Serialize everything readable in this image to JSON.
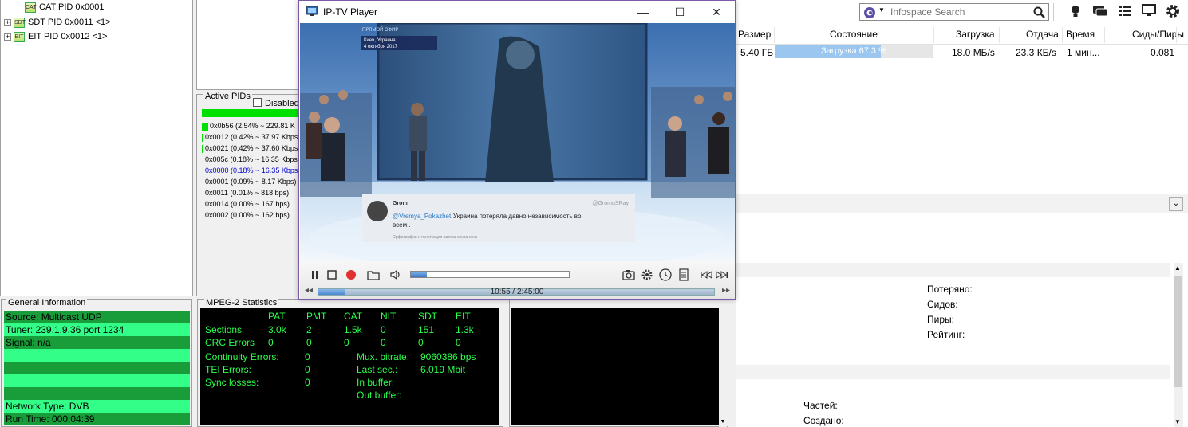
{
  "tree": {
    "items": [
      {
        "label": "CAT PID 0x0001",
        "expandable": false,
        "icon_text": "CAT"
      },
      {
        "label": "SDT PID 0x0011 <1>",
        "expandable": true,
        "icon_text": "SDT"
      },
      {
        "label": "EIT PID 0x0012 <1>",
        "expandable": true,
        "icon_text": "EIT"
      }
    ],
    "expand_glyph": "+"
  },
  "active_pids": {
    "title": "Active PIDs",
    "disabled_label": "Disabled",
    "rows": [
      {
        "text": "0x0b56 (2.54% ~ 229.81 K",
        "color": "#000000",
        "bar": "full"
      },
      {
        "text": "0x0012 (0.42% ~ 37.97 Kbps",
        "color": "#000000",
        "bar": "thin"
      },
      {
        "text": "0x0021 (0.42% ~ 37.60 Kbps",
        "color": "#000000",
        "bar": "thin"
      },
      {
        "text": "0x005c (0.18% ~ 16.35 Kbps",
        "color": "#000000",
        "bar": "none"
      },
      {
        "text": "0x0000 (0.18% ~ 16.35 Kbps",
        "color": "#0000cc",
        "bar": "none"
      },
      {
        "text": "0x0001 (0.09% ~ 8.17 Kbps)",
        "color": "#000000",
        "bar": "none"
      },
      {
        "text": "0x0011 (0.01% ~ 818 bps)",
        "color": "#000000",
        "bar": "none"
      },
      {
        "text": "0x0014 (0.00% ~ 167 bps)",
        "color": "#000000",
        "bar": "none"
      },
      {
        "text": "0x0002 (0.00% ~ 162 bps)",
        "color": "#000000",
        "bar": "none"
      }
    ]
  },
  "general_info": {
    "title": "General Information",
    "rows": [
      "Source: Multicast UDP",
      "Tuner: 239.1.9.36 port 1234",
      "Signal: n/a",
      "",
      "",
      "",
      "",
      "Network Type: DVB",
      "Run Time: 000:04:39"
    ]
  },
  "mpeg_stats": {
    "title": "MPEG-2 Statistics",
    "columns": [
      "PAT",
      "PMT",
      "CAT",
      "NIT",
      "SDT",
      "EIT"
    ],
    "sections_label": "Sections",
    "sections": [
      "3.0k",
      "2",
      "1.5k",
      "0",
      "151",
      "1.3k"
    ],
    "crc_label": "CRC Errors",
    "crc": [
      "0",
      "0",
      "0",
      "0",
      "0",
      "0"
    ],
    "continuity_label": "Continuity Errors:",
    "continuity": "0",
    "tei_label": "TEI Errors:",
    "tei": "0",
    "sync_label": "Sync losses:",
    "sync": "0",
    "mux_label": "Mux. bitrate:",
    "mux": "9060386 bps",
    "last_label": "Last sec.:",
    "last": "6.019 Mbit",
    "inbuf_label": "In buffer:",
    "outbuf_label": "Out buffer:"
  },
  "player": {
    "title": "IP-TV Player",
    "minimize_glyph": "—",
    "maximize_glyph": "☐",
    "close_glyph": "✕",
    "time": "10:55 / 2:45:00",
    "seek_fraction": 0.066,
    "volume_fraction": 0.1,
    "video": {
      "caption_top": "ПРЯМОЙ ЭФИР",
      "location_line1": "Киев, Украина",
      "location_line2": "4 октября 2017",
      "tweet_user": "Grom",
      "tweet_handle": "@GromuSRay",
      "tweet_mention": "@Vremya_Pokazhet",
      "tweet_text1": "Украина потеряла давно независимость во",
      "tweet_text2": "всем..",
      "tweet_footer": "Орфография и пунктуация автора сохранены"
    }
  },
  "torrent": {
    "search_placeholder": "Infospace Search",
    "columns": [
      "Размер",
      "Состояние",
      "Загрузка",
      "Отдача",
      "Время",
      "Сиды/Пиры"
    ],
    "row": {
      "size": "5.40 ГБ",
      "status": "Загрузка 67.3 %",
      "progress_fraction": 0.673,
      "down": "18.0 МБ/s",
      "up": "23.3 КБ/s",
      "time": "1 мин...",
      "ratio": "0.081"
    },
    "collapse_glyph": "⌄",
    "info_labels": [
      "Потеряно:",
      "Сидов:",
      "Пиры:",
      "Рейтинг:"
    ],
    "info_labels2": [
      "Частей:",
      "Создано:"
    ]
  },
  "colors": {
    "accent_green": "#00e000",
    "stats_green": "#2bff4a",
    "progress_blue": "#9ac6f0",
    "window_border": "#7a5aa6"
  }
}
